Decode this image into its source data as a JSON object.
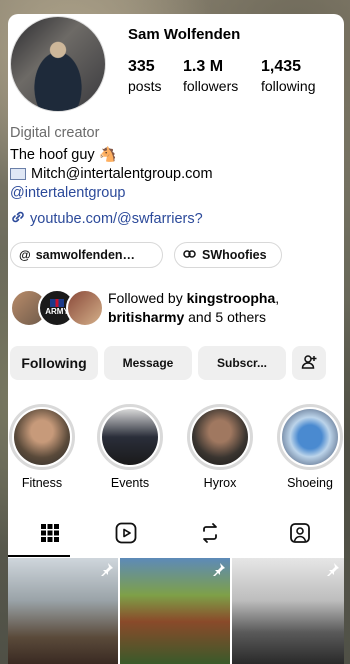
{
  "profile": {
    "name": "Sam Wolfenden",
    "posts_count": "335",
    "posts_label": "posts",
    "followers_count": "1.3 M",
    "followers_label": "followers",
    "following_count": "1,435",
    "following_label": "following",
    "category": "Digital creator",
    "bio_line1": "The hoof guy 🐴",
    "bio_line2": "Mitch@intertalentgroup.com",
    "mention": "@intertalentgroup",
    "link": "youtube.com/@swfarriers?"
  },
  "chips": [
    {
      "label": "samwolfenden…",
      "icon": "threads-icon"
    },
    {
      "label": "SWhoofies",
      "icon": "link-icon"
    }
  ],
  "followed_by": {
    "prefix": "Followed by ",
    "user1": "kingstroopha",
    "sep": ",",
    "user2": "britisharmy",
    "suffix": " and 5 others",
    "army_text": "ARMY"
  },
  "buttons": {
    "following": "Following",
    "message": "Message",
    "subscribe": "Subscr..."
  },
  "highlights": [
    {
      "label": "Fitness"
    },
    {
      "label": "Events"
    },
    {
      "label": "Hyrox"
    },
    {
      "label": "Shoeing"
    }
  ],
  "tabs": [
    "grid-icon",
    "reels-icon",
    "reposts-icon",
    "tagged-icon"
  ],
  "colors": {
    "link": "#2c4a9a",
    "muted": "#6b6b6b",
    "button_bg": "#efefef"
  }
}
